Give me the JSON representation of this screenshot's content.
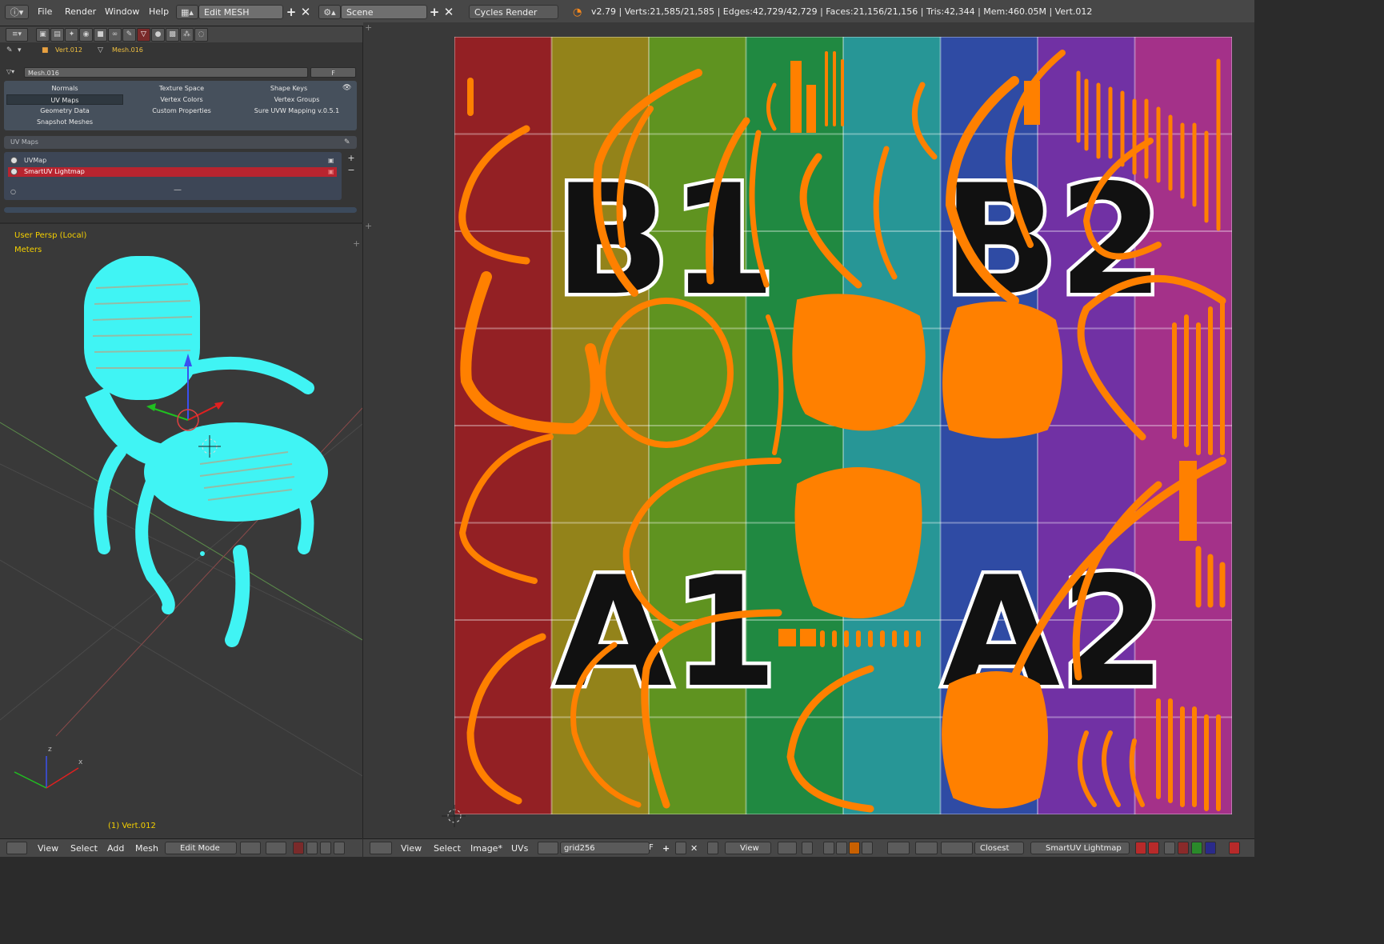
{
  "top_bar": {
    "menus": [
      "File",
      "Render",
      "Window",
      "Help"
    ],
    "screen_layout": "Edit MESH",
    "scene": "Scene",
    "render_engine": "Cycles Render",
    "stats": "v2.79 | Verts:21,585/21,585 | Edges:42,729/42,729 | Faces:21,156/21,156 | Tris:42,344 | Mem:460.05M | Vert.012"
  },
  "properties": {
    "context_object": "Vert.012",
    "context_mesh": "Mesh.016",
    "mesh_name": "Mesh.016",
    "fake_user": "F",
    "panels": [
      "Normals",
      "Texture Space",
      "Shape Keys",
      "UV Maps",
      "Vertex Colors",
      "Vertex Groups",
      "Geometry Data",
      "Custom Properties",
      "Sure UVW Mapping v.0.5.1",
      "Snapshot Meshes"
    ],
    "uv_maps_title": "UV Maps",
    "uv_maps": [
      "UVMap",
      "SmartUV Lightmap"
    ],
    "active_uv_map": "SmartUV Lightmap"
  },
  "viewport3d": {
    "view_label": "User Persp (Local)",
    "units_label": "Meters",
    "object_info": "(1) Vert.012",
    "axis_labels": [
      "z",
      "x"
    ]
  },
  "uv_editor": {
    "grid_labels": [
      "B1",
      "B2",
      "A1",
      "A2"
    ],
    "column_colors": [
      "#b4282c",
      "#b4a020",
      "#74b428",
      "#28a850",
      "#30b8b8",
      "#3a5cc8",
      "#8a3cc8",
      "#c83ca8"
    ],
    "island_color": "#ff8000"
  },
  "bottom_bar_3d": {
    "menus": [
      "View",
      "Select",
      "Add",
      "Mesh"
    ],
    "mode": "Edit Mode"
  },
  "bottom_bar_uv": {
    "menus": [
      "View",
      "Select",
      "Image*",
      "UVs"
    ],
    "image_name": "grid256",
    "fake_user": "F",
    "view_dropdown": "View",
    "pivot_snap": "Closest",
    "uv_map_dropdown": "SmartUV Lightmap"
  }
}
